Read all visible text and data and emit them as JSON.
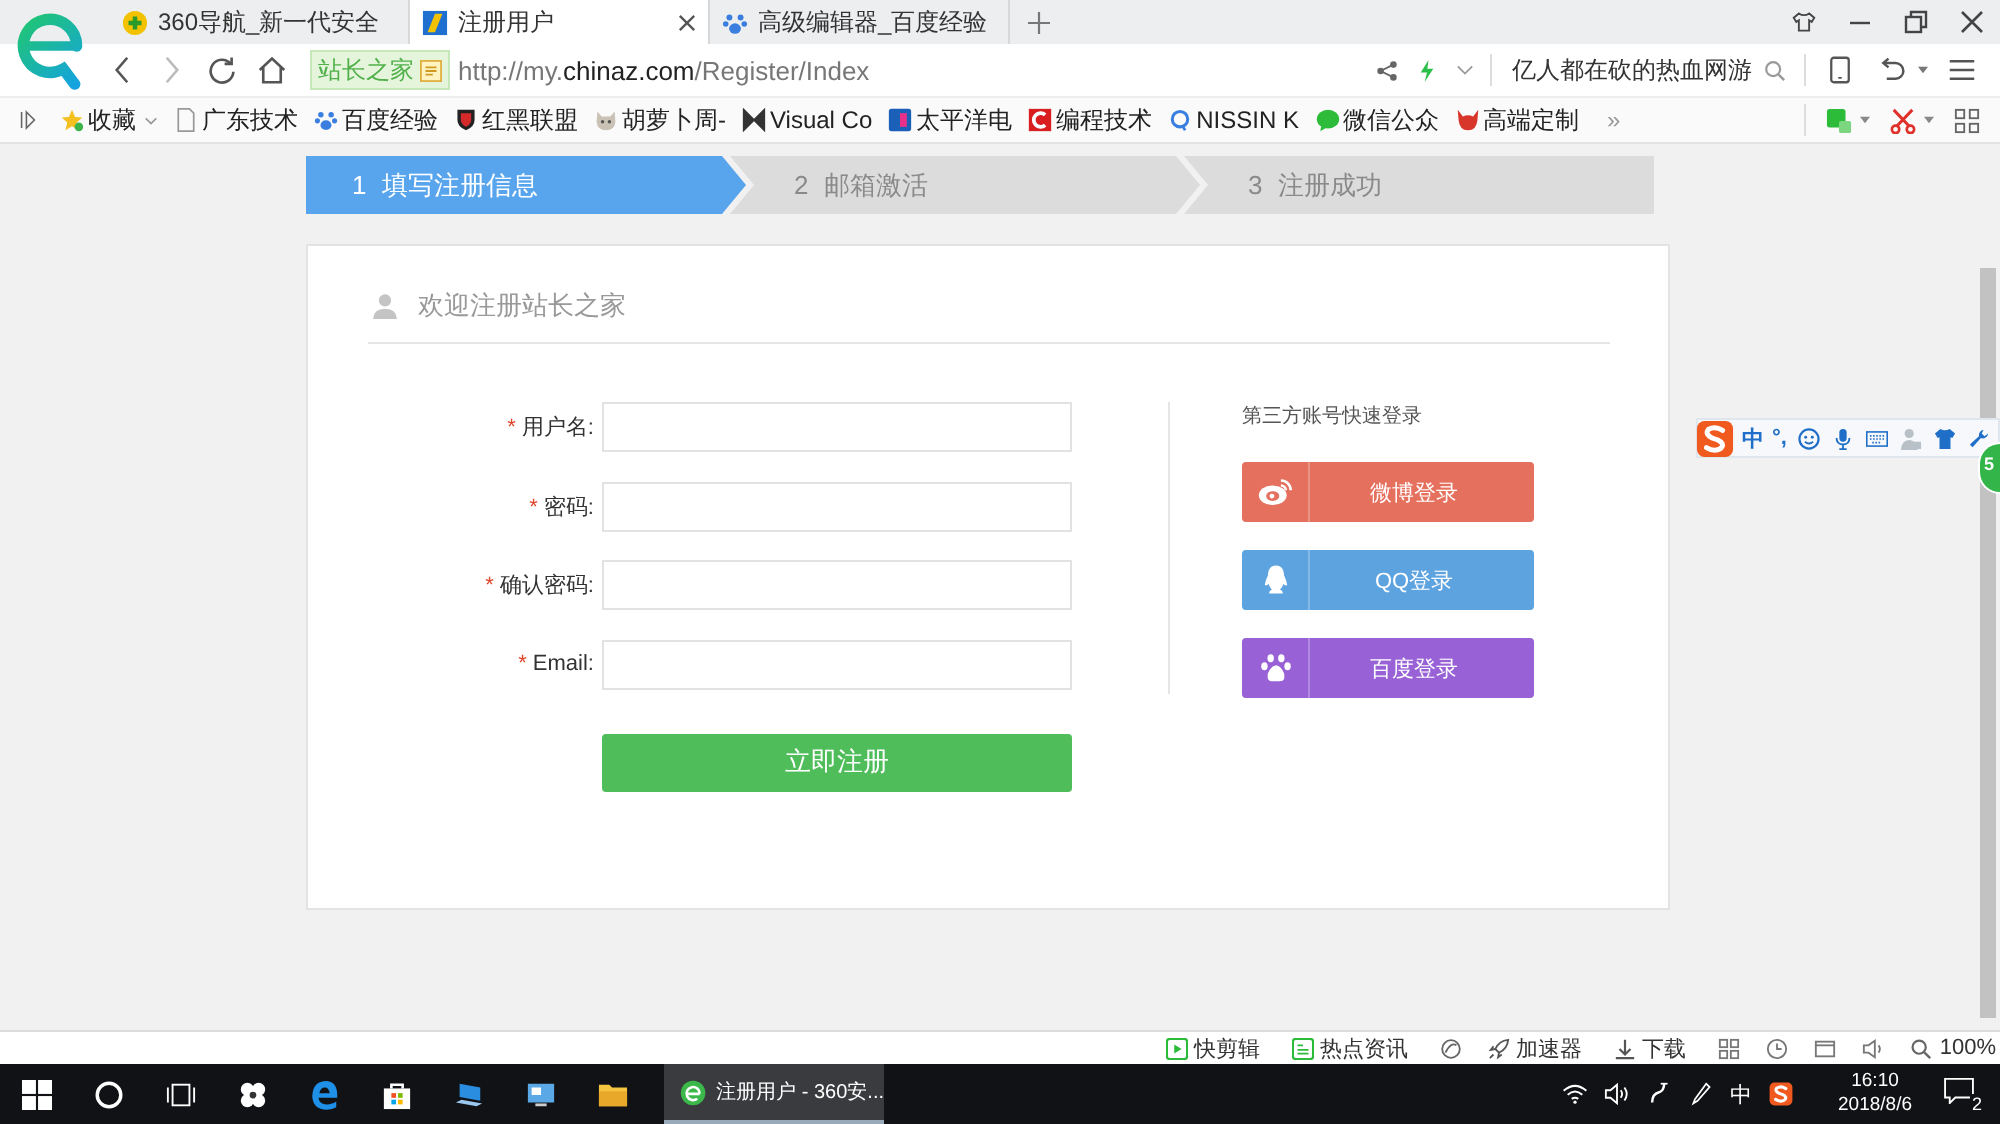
{
  "browser": {
    "tabs": [
      {
        "title": "360导航_新一代安全",
        "selected": false
      },
      {
        "title": "注册用户",
        "selected": true
      },
      {
        "title": "高级编辑器_百度经验",
        "selected": false
      }
    ],
    "site_badge": "站长之家",
    "url": {
      "scheme": "http://my.",
      "domain": "chinaz.com",
      "path": "/Register/Index"
    },
    "search": {
      "placeholder": "亿人都在砍的热血网游"
    },
    "bookmarks": [
      {
        "label": "收藏"
      },
      {
        "label": "广东技术"
      },
      {
        "label": "百度经验"
      },
      {
        "label": "红黑联盟"
      },
      {
        "label": "胡萝卜周-"
      },
      {
        "label": "Visual Co"
      },
      {
        "label": "太平洋电"
      },
      {
        "label": "编程技术"
      },
      {
        "label": "NISSIN K"
      },
      {
        "label": "微信公众"
      },
      {
        "label": "高端定制"
      }
    ],
    "more": "»"
  },
  "steps": [
    {
      "number": "1",
      "label": "填写注册信息",
      "selected": true
    },
    {
      "number": "2",
      "label": "邮箱激活",
      "selected": false
    },
    {
      "number": "3",
      "label": "注册成功",
      "selected": false
    }
  ],
  "card": {
    "title": "欢迎注册站长之家",
    "fields": [
      {
        "mark": "*",
        "label": "用户名:"
      },
      {
        "mark": "*",
        "label": "密码:"
      },
      {
        "mark": "*",
        "label": "确认密码:"
      },
      {
        "mark": "*",
        "label": "Email:"
      }
    ],
    "submit": "立即注册",
    "social": {
      "title": "第三方账号快速登录",
      "buttons": [
        {
          "kind": "weibo",
          "label": "微博登录",
          "color": "#e5705e"
        },
        {
          "kind": "qq",
          "label": "QQ登录",
          "color": "#5da3df"
        },
        {
          "kind": "baidu",
          "label": "百度登录",
          "color": "#9861d6"
        }
      ]
    }
  },
  "ime": {
    "mode": "中",
    "punct": "°,"
  },
  "float_ball": {
    "count": "5"
  },
  "status_bar": {
    "items": [
      {
        "label": "快剪辑"
      },
      {
        "label": "热点资讯"
      },
      {
        "label": "加速器"
      },
      {
        "label": "下载"
      }
    ],
    "zoom": "100%"
  },
  "taskbar": {
    "active_app": "注册用户 - 360安...",
    "ime": "中",
    "time": "16:10",
    "date": "2018/8/6",
    "notifications": "2"
  }
}
